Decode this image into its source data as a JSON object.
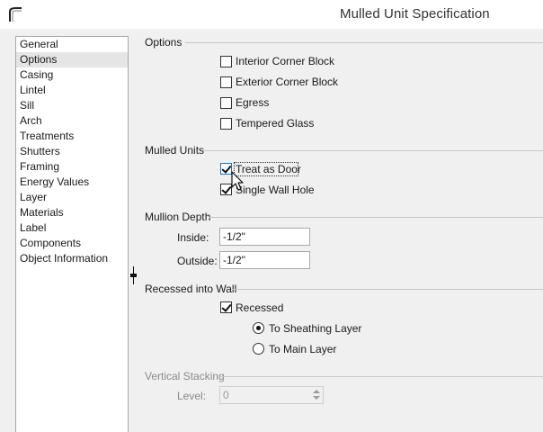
{
  "window": {
    "title": "Mulled Unit Specification"
  },
  "nav": {
    "items": [
      {
        "label": "General"
      },
      {
        "label": "Options",
        "selected": true
      },
      {
        "label": "Casing"
      },
      {
        "label": "Lintel"
      },
      {
        "label": "Sill"
      },
      {
        "label": "Arch"
      },
      {
        "label": "Treatments"
      },
      {
        "label": "Shutters"
      },
      {
        "label": "Framing"
      },
      {
        "label": "Energy Values"
      },
      {
        "label": "Layer"
      },
      {
        "label": "Materials"
      },
      {
        "label": "Label"
      },
      {
        "label": "Components"
      },
      {
        "label": "Object Information"
      }
    ]
  },
  "options": {
    "heading": "Options",
    "interior_corner_block": {
      "label": "Interior Corner Block",
      "checked": false
    },
    "exterior_corner_block": {
      "label": "Exterior Corner Block",
      "checked": false
    },
    "egress": {
      "label": "Egress",
      "checked": false
    },
    "tempered_glass": {
      "label": "Tempered Glass",
      "checked": false
    }
  },
  "mulled_units": {
    "heading": "Mulled Units",
    "treat_as_door": {
      "label": "Treat as Door",
      "checked": true
    },
    "single_wall_hole": {
      "label": "Single Wall Hole",
      "checked": true
    }
  },
  "mullion_depth": {
    "heading": "Mullion Depth",
    "inside_label": "Inside:",
    "inside_value": "-1/2\"",
    "outside_label": "Outside:",
    "outside_value": "-1/2\""
  },
  "recessed": {
    "heading": "Recessed into Wall",
    "recessed": {
      "label": "Recessed",
      "checked": true
    },
    "to_sheathing_layer": {
      "label": "To Sheathing Layer",
      "selected": true
    },
    "to_main_layer": {
      "label": "To Main Layer",
      "selected": false
    }
  },
  "vertical_stacking": {
    "heading": "Vertical Stacking",
    "level_label": "Level:",
    "level_value": "0"
  }
}
